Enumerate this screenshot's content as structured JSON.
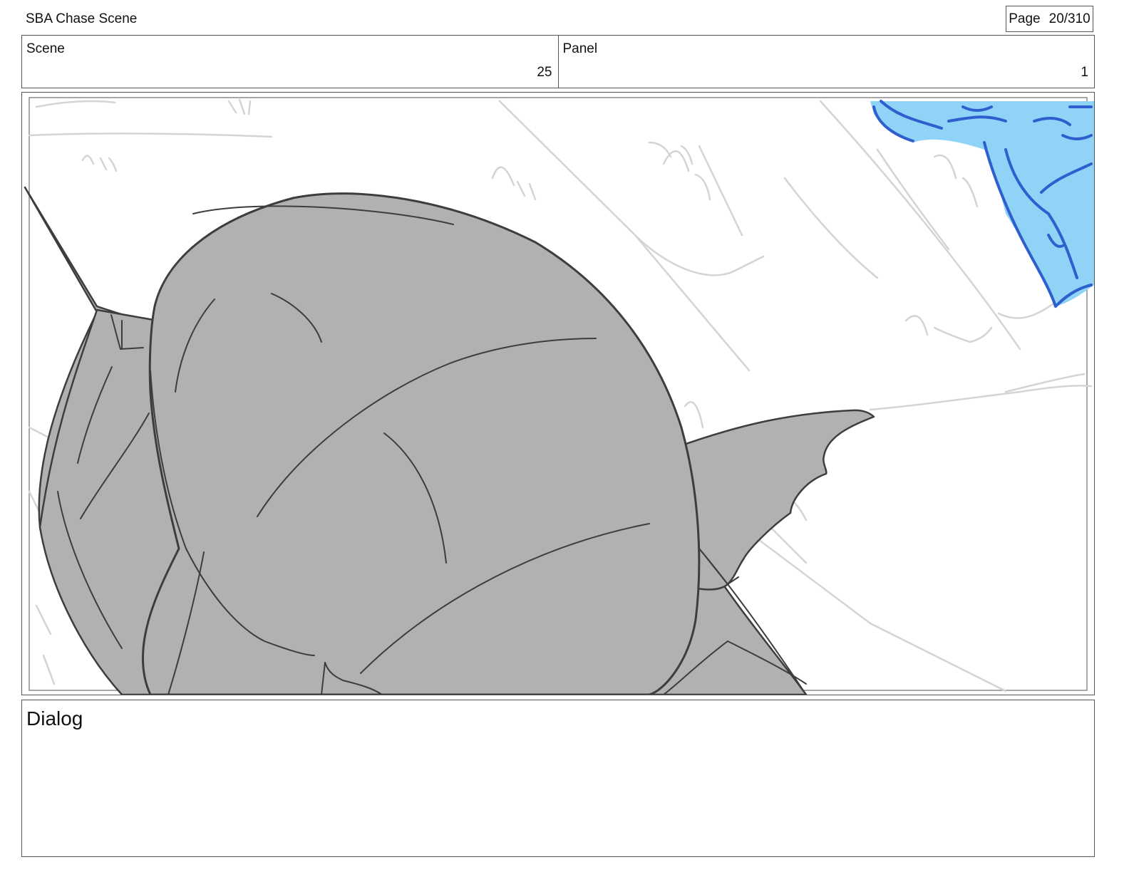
{
  "header": {
    "doc_title": "SBA Chase Scene",
    "page_label": "Page",
    "page_value": "20/310"
  },
  "scene": {
    "label": "Scene",
    "value": "25"
  },
  "panel": {
    "label": "Panel",
    "value": "1"
  },
  "dialog": {
    "label": "Dialog"
  },
  "colors": {
    "creature_fill": "#b1b1b1",
    "sketch_lines": "#d6d6d6",
    "blue_fill": "#8fd3f6",
    "blue_line": "#2f5fcf"
  }
}
